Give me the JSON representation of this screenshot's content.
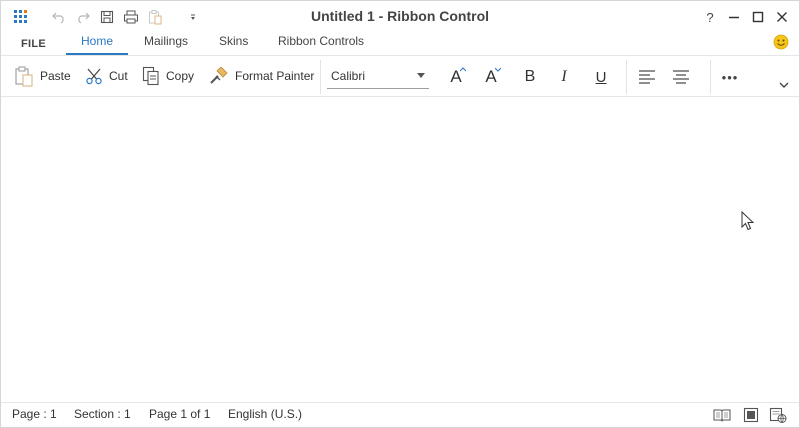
{
  "window": {
    "title": "Untitled 1 - Ribbon Control",
    "help_label": "?"
  },
  "tabs": {
    "file": "FILE",
    "home": "Home",
    "mailings": "Mailings",
    "skins": "Skins",
    "ribbon_controls": "Ribbon Controls",
    "active": "Home"
  },
  "ribbon": {
    "paste": "Paste",
    "cut": "Cut",
    "copy": "Copy",
    "format_painter": "Format Painter",
    "font_name": "Calibri",
    "bold": "B",
    "italic": "I",
    "underline": "U",
    "grow_font": "A",
    "shrink_font": "A",
    "more": "•••"
  },
  "statusbar": {
    "page": "Page : 1",
    "section": "Section : 1",
    "page_of": "Page 1 of 1",
    "language": "English (U.S.)"
  },
  "colors": {
    "accent": "#2b78c5",
    "grid_icon": "#e8760a",
    "smiley": "#f5c518"
  }
}
